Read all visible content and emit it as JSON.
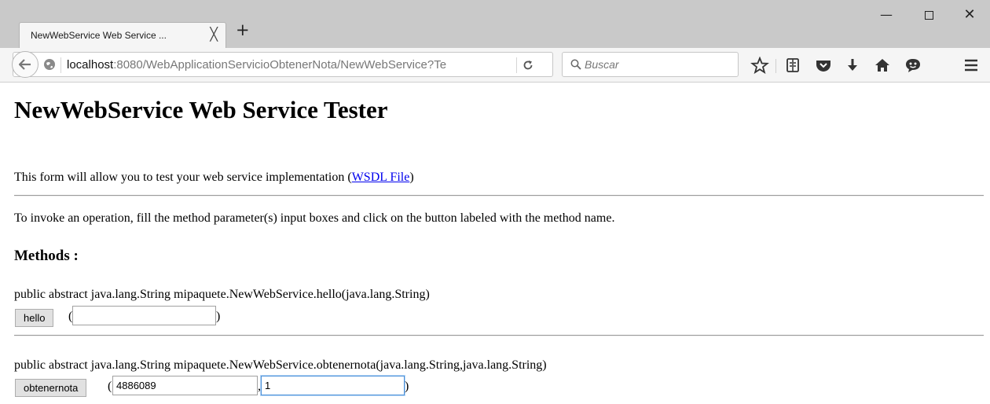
{
  "browser": {
    "tab_title": "NewWebService Web Service ...",
    "tab_close": "╳",
    "new_tab": "+",
    "window_controls": {
      "minimize": "—",
      "close": "✕"
    },
    "url_host": "localhost",
    "url_rest": ":8080/WebApplicationServicioObtenerNota/NewWebService?Te",
    "reload_glyph": "C",
    "search_placeholder": "Buscar",
    "icons": [
      "back-arrow-icon",
      "globe-icon",
      "reload-icon",
      "search-icon",
      "bookmark-star-icon",
      "reading-list-icon",
      "pocket-icon",
      "download-icon",
      "home-icon",
      "chat-icon",
      "menu-icon"
    ]
  },
  "page": {
    "title": "NewWebService Web Service Tester",
    "intro_text": "This form will allow you to test your web service implementation (",
    "wsdl_link": "WSDL File",
    "intro_close": ")",
    "instructions": "To invoke an operation, fill the method parameter(s) input boxes and click on the button labeled with the method name.",
    "methods_heading": "Methods :",
    "methods": [
      {
        "signature": "public abstract java.lang.String mipaquete.NewWebService.hello(java.lang.String)",
        "button": "hello",
        "open_paren": "(",
        "close_paren": ")",
        "params": [
          ""
        ]
      },
      {
        "signature": "public abstract java.lang.String mipaquete.NewWebService.obtenernota(java.lang.String,java.lang.String)",
        "button": "obtenernota",
        "open_paren": "(",
        "separator": ",",
        "close_paren": ")",
        "params": [
          "4886089",
          "1"
        ]
      }
    ]
  }
}
